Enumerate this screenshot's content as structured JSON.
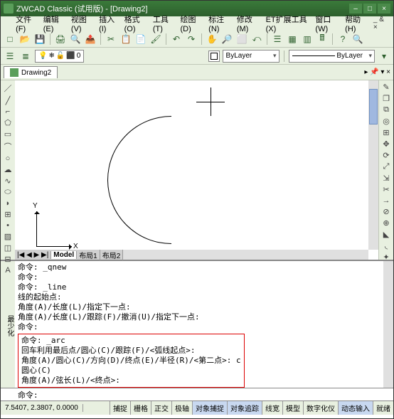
{
  "title": "ZWCAD Classic (试用版) - [Drawing2]",
  "menu": [
    "文件(F)",
    "编辑(E)",
    "视图(V)",
    "插入(I)",
    "格式(O)",
    "工具(T)",
    "绘图(D)",
    "标注(N)",
    "修改(M)",
    "ET扩展工具(X)",
    "窗口(W)",
    "帮助(H)"
  ],
  "menu_sub": "_ & ×",
  "layer_name": "0",
  "prop_color": "ByLayer",
  "prop_linetype": "ByLayer",
  "doc_tab": "Drawing2",
  "pin_btns": "▸ 📌 ▾ ×",
  "model_tabs": {
    "nav": "|◀ ◀ ▶ ▶|",
    "t1": "Model",
    "t2": "布局1",
    "t3": "布局2"
  },
  "ucs": {
    "x": "X",
    "y": "Y"
  },
  "cmd_side": "最少化",
  "cmd_lines": [
    "命令: _qnew",
    "命令:",
    "命令: _line",
    "线的起始点:",
    "角度(A)/长度(L)/指定下一点:",
    "角度(A)/长度(L)/跟踪(F)/撤消(U)/指定下一点:",
    "命令:"
  ],
  "cmd_hl": [
    "命令: _arc",
    "回车利用最后点/圆心(C)/跟踪(F)/<弧线起点>:",
    "角度(A)/圆心(C)/方向(D)/终点(E)/半径(R)/<第二点>: c",
    "圆心(C)",
    "角度(A)/弦长(L)/<终点>:"
  ],
  "cmd_prompt": "命令:",
  "coords": "7.5407, 2.3807, 0.0000",
  "status_btns": [
    "捕捉",
    "栅格",
    "正交",
    "极轴",
    "对象捕捉",
    "对象追踪",
    "线宽",
    "模型",
    "数字化仪",
    "动态输入",
    "就绪"
  ],
  "status_active": [
    4,
    5,
    9
  ]
}
